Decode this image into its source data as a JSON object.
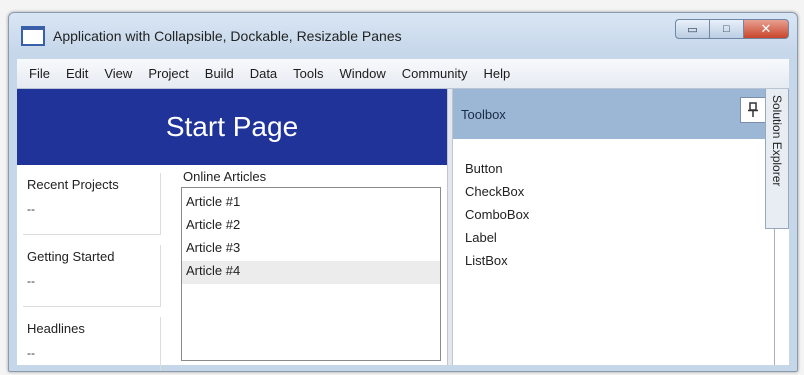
{
  "window": {
    "title": "Application with Collapsible, Dockable, Resizable Panes",
    "controls": {
      "minimize": "▭",
      "maximize": "□",
      "close": "✕"
    }
  },
  "menu": [
    "File",
    "Edit",
    "View",
    "Project",
    "Build",
    "Data",
    "Tools",
    "Window",
    "Community",
    "Help"
  ],
  "start_page": {
    "title": "Start Page",
    "groups": [
      {
        "title": "Recent Projects",
        "value": "--"
      },
      {
        "title": "Getting Started",
        "value": "--"
      },
      {
        "title": "Headlines",
        "value": "--"
      }
    ],
    "articles": {
      "title": "Online Articles",
      "items": [
        "Article #1",
        "Article #2",
        "Article #3",
        "Article #4"
      ],
      "selected_index": 3
    }
  },
  "toolbox": {
    "title": "Toolbox",
    "pin_icon": "pin-icon",
    "items": [
      "Button",
      "CheckBox",
      "ComboBox",
      "Label",
      "ListBox"
    ]
  },
  "side_tab": {
    "label": "Solution Explorer"
  }
}
